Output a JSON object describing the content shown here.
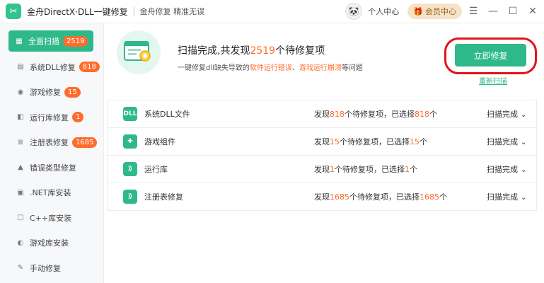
{
  "titlebar": {
    "app_title": "金舟DirectX·DLL一键修复",
    "slogan": "金舟修复 精准无误",
    "user_center": "个人中心",
    "member_center": "会员中心",
    "menu_icon": "menu-icon",
    "minimize_icon": "minimize-icon",
    "maximize_icon": "maximize-icon",
    "close_icon": "close-icon"
  },
  "sidebar": {
    "items": [
      {
        "label": "全面扫描",
        "badge": "2519",
        "icon": "scan-icon"
      },
      {
        "label": "系统DLL修复",
        "badge": "818",
        "icon": "dll-icon"
      },
      {
        "label": "游戏修复",
        "badge": "15",
        "icon": "gamepad-icon"
      },
      {
        "label": "运行库修复",
        "badge": "1",
        "icon": "runtime-icon"
      },
      {
        "label": "注册表修复",
        "badge": "1685",
        "icon": "registry-icon"
      },
      {
        "label": "错误类型修复",
        "badge": "",
        "icon": "warning-icon"
      },
      {
        "label": ".NET库安装",
        "badge": "",
        "icon": "dotnet-icon"
      },
      {
        "label": "C++库安装",
        "badge": "",
        "icon": "cpp-icon"
      },
      {
        "label": "游戏库安装",
        "badge": "",
        "icon": "game-lib-icon"
      },
      {
        "label": "手动修复",
        "badge": "",
        "icon": "wrench-icon"
      }
    ]
  },
  "summary": {
    "title_prefix": "扫描完成,共发现",
    "title_count": "2519",
    "title_suffix": "个待修复项",
    "desc_prefix": "一键修复dll缺失导致的",
    "desc_hl1": "软件运行错误",
    "desc_sep": "、",
    "desc_hl2": "游戏运行崩溃",
    "desc_suffix": "等问题",
    "repair_button": "立即修复",
    "rescan_link": "重新扫描"
  },
  "rows": [
    {
      "name": "系统DLL文件",
      "icon_text": "DLL",
      "found_pre": "发现",
      "found": "818",
      "found_mid": "个待修复项，已选择",
      "selected": "818",
      "found_suf": "个",
      "done": "扫描完成"
    },
    {
      "name": "游戏组件",
      "icon_text": "✚",
      "found_pre": "发现",
      "found": "15",
      "found_mid": "个待修复项，已选择",
      "selected": "15",
      "found_suf": "个",
      "done": "扫描完成"
    },
    {
      "name": "运行库",
      "icon_text": "⟫",
      "found_pre": "发现",
      "found": "1",
      "found_mid": "个待修复项，已选择",
      "selected": "1",
      "found_suf": "个",
      "done": "扫描完成"
    },
    {
      "name": "注册表修复",
      "icon_text": "⟫",
      "found_pre": "发现",
      "found": "1685",
      "found_mid": "个待修复项，已选择",
      "selected": "1685",
      "found_suf": "个",
      "done": "扫描完成"
    }
  ],
  "colors": {
    "accent": "#2fb98a",
    "highlight": "#ff6b2b",
    "ring": "#e0141b"
  }
}
